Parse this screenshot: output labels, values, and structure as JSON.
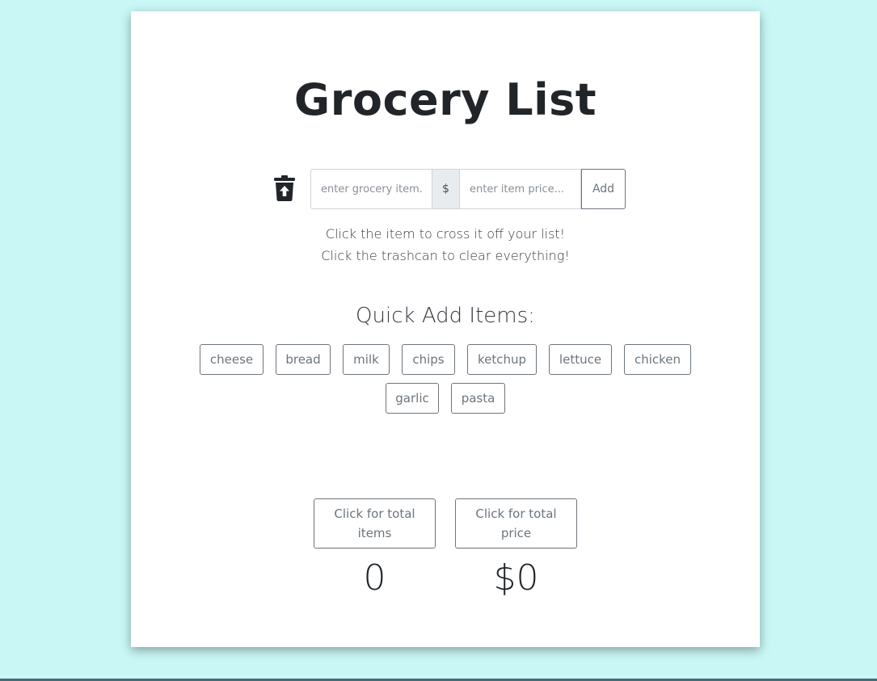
{
  "header": {
    "title": "Grocery List"
  },
  "form": {
    "item_placeholder": "enter grocery item...",
    "currency_symbol": "$",
    "price_placeholder": "enter item price...",
    "add_label": "Add",
    "trash_icon": "trash-upload-icon"
  },
  "instructions": {
    "line1": "Click the item to cross it off your list!",
    "line2": "Click the trashcan to clear everything!"
  },
  "quick_add": {
    "title": "Quick Add Items:",
    "items": [
      "cheese",
      "bread",
      "milk",
      "chips",
      "ketchup",
      "lettuce",
      "chicken",
      "garlic",
      "pasta"
    ]
  },
  "totals": {
    "items_button_label": "Click for total items",
    "price_button_label": "Click for total price",
    "items_value": "0",
    "price_value": "$0"
  },
  "colors": {
    "background": "#c8f7f5",
    "card": "#ffffff",
    "button_border": "#6c757d",
    "text": "#212529"
  }
}
